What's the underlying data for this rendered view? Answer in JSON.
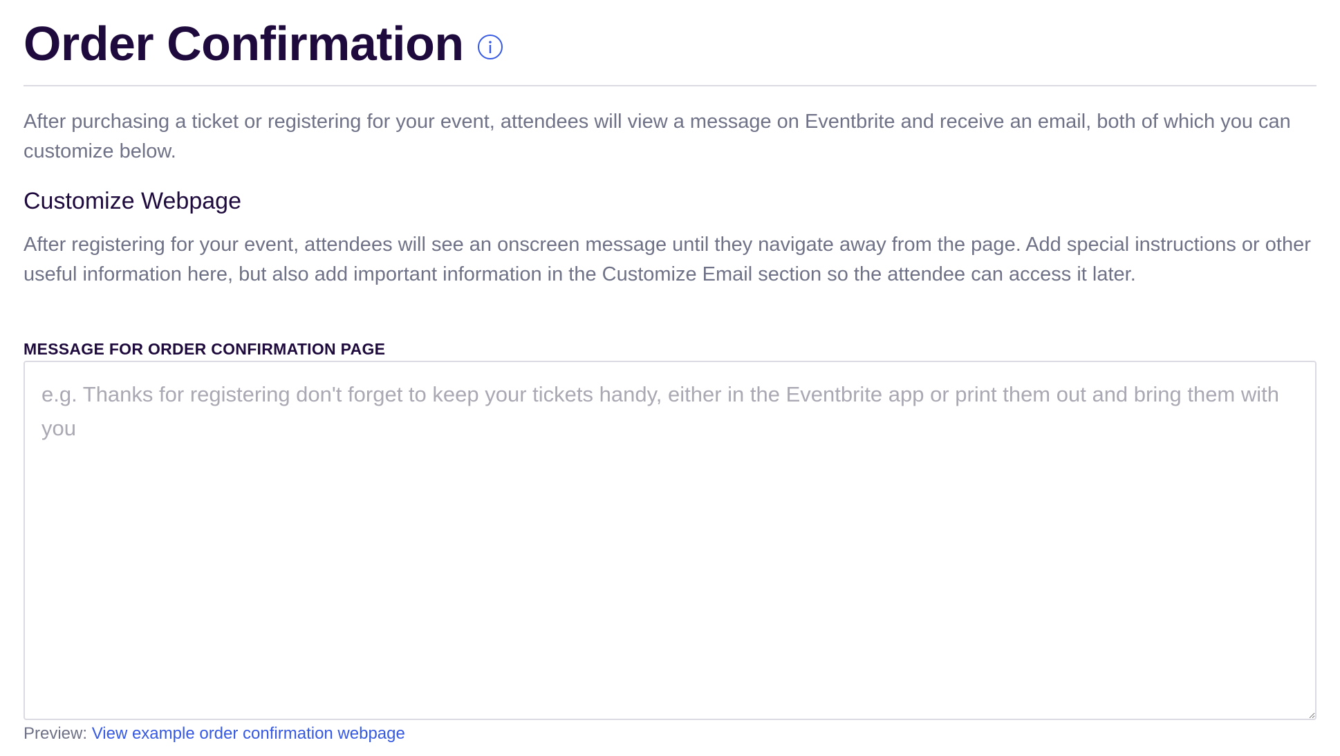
{
  "header": {
    "title": "Order Confirmation",
    "info_icon": "info-circle-icon"
  },
  "intro": {
    "text": "After purchasing a ticket or registering for your event, attendees will view a message on Eventbrite and receive an email, both of which you can customize below."
  },
  "customize_webpage": {
    "heading": "Customize Webpage",
    "description": "After registering for your event, attendees will see an onscreen message until they navigate away from the page. Add special instructions or other useful information here, but also add important information in the Customize Email section so the attendee can access it later.",
    "field_label": "MESSAGE FOR ORDER CONFIRMATION PAGE",
    "field_value": "",
    "field_placeholder": "e.g. Thanks for registering don't forget to keep your tickets handy, either in the Eventbrite app or print them out and bring them with you",
    "preview_prefix": "Preview:",
    "preview_link_label": "View example order confirmation webpage"
  },
  "colors": {
    "heading": "#1e0a3c",
    "body_text": "#6f7287",
    "link": "#3659e3",
    "border": "#dbdae3",
    "placeholder": "#a9a8b3"
  }
}
